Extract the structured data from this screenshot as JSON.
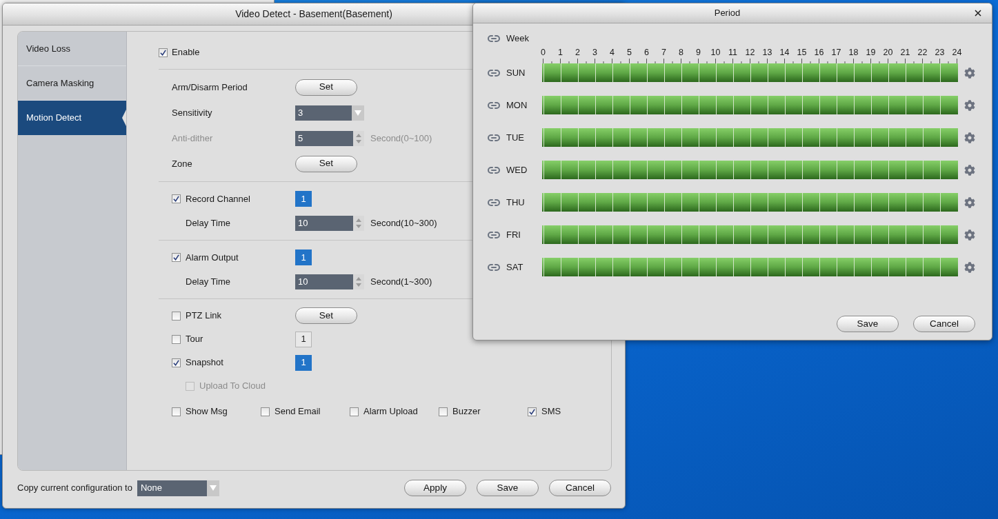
{
  "main_window": {
    "title": "Video Detect - Basement(Basement)",
    "sidebar": {
      "items": [
        {
          "label": "Video Loss",
          "selected": false
        },
        {
          "label": "Camera Masking",
          "selected": false
        },
        {
          "label": "Motion Detect",
          "selected": true
        }
      ]
    },
    "enable": {
      "label": "Enable",
      "checked": true
    },
    "sections": [
      [
        {
          "label": "Arm/Disarm Period",
          "disabled": false,
          "control": {
            "kind": "button",
            "label": "Set"
          }
        },
        {
          "label": "Sensitivity",
          "disabled": false,
          "control": {
            "kind": "dropdown",
            "value": "3"
          }
        },
        {
          "label": "Anti-dither",
          "disabled": true,
          "control": {
            "kind": "spinner",
            "value": "5",
            "unit": "Second(0~100)"
          }
        },
        {
          "label": "Zone",
          "disabled": false,
          "control": {
            "kind": "button",
            "label": "Set"
          }
        }
      ],
      [
        {
          "label": "Record Channel",
          "checked": true,
          "disabled": false,
          "control": {
            "kind": "channels",
            "channels": [
              {
                "label": "1",
                "selected": true
              }
            ]
          },
          "children": [
            {
              "label": "Delay Time",
              "disabled": false,
              "control": {
                "kind": "spinner",
                "value": "10",
                "unit": "Second(10~300)"
              }
            }
          ]
        }
      ],
      [
        {
          "label": "Alarm Output",
          "checked": true,
          "disabled": false,
          "control": {
            "kind": "channels",
            "channels": [
              {
                "label": "1",
                "selected": true
              }
            ]
          },
          "children": [
            {
              "label": "Delay Time",
              "disabled": false,
              "control": {
                "kind": "spinner",
                "value": "10",
                "unit": "Second(1~300)"
              }
            }
          ]
        }
      ],
      [
        {
          "label": "PTZ Link",
          "checked": false,
          "disabled": false,
          "control": {
            "kind": "button",
            "label": "Set"
          }
        },
        {
          "label": "Tour",
          "checked": false,
          "disabled": false,
          "control": {
            "kind": "channels",
            "channels": [
              {
                "label": "1",
                "selected": false
              }
            ]
          }
        },
        {
          "label": "Snapshot",
          "checked": true,
          "disabled": false,
          "control": {
            "kind": "channels",
            "channels": [
              {
                "label": "1",
                "selected": true
              }
            ]
          },
          "children": [
            {
              "label": "Upload To Cloud",
              "checked": false,
              "disabled": true
            }
          ]
        }
      ]
    ],
    "alarm_options": [
      {
        "label": "Show Msg",
        "checked": false
      },
      {
        "label": "Send Email",
        "checked": false
      },
      {
        "label": "Alarm Upload",
        "checked": false
      },
      {
        "label": "Buzzer",
        "checked": false
      },
      {
        "label": "SMS",
        "checked": true
      }
    ],
    "copy_to": {
      "label": "Copy current configuration to",
      "value": "None"
    },
    "buttons": [
      "Apply",
      "Save",
      "Cancel"
    ]
  },
  "period_dialog": {
    "title": "Period",
    "week": {
      "label": "Week"
    },
    "hours": [
      "0",
      "1",
      "2",
      "3",
      "4",
      "5",
      "6",
      "7",
      "8",
      "9",
      "10",
      "11",
      "12",
      "13",
      "14",
      "15",
      "16",
      "17",
      "18",
      "19",
      "20",
      "21",
      "22",
      "23",
      "24"
    ],
    "days": [
      {
        "label": "SUN",
        "level": 1
      },
      {
        "label": "MON",
        "level": 1
      },
      {
        "label": "TUE",
        "level": 1
      },
      {
        "label": "WED",
        "level": 1
      },
      {
        "label": "THU",
        "level": 1
      },
      {
        "label": "FRI",
        "level": 1
      },
      {
        "label": "SAT",
        "level": 1
      }
    ],
    "buttons": [
      "Save",
      "Cancel"
    ]
  }
}
